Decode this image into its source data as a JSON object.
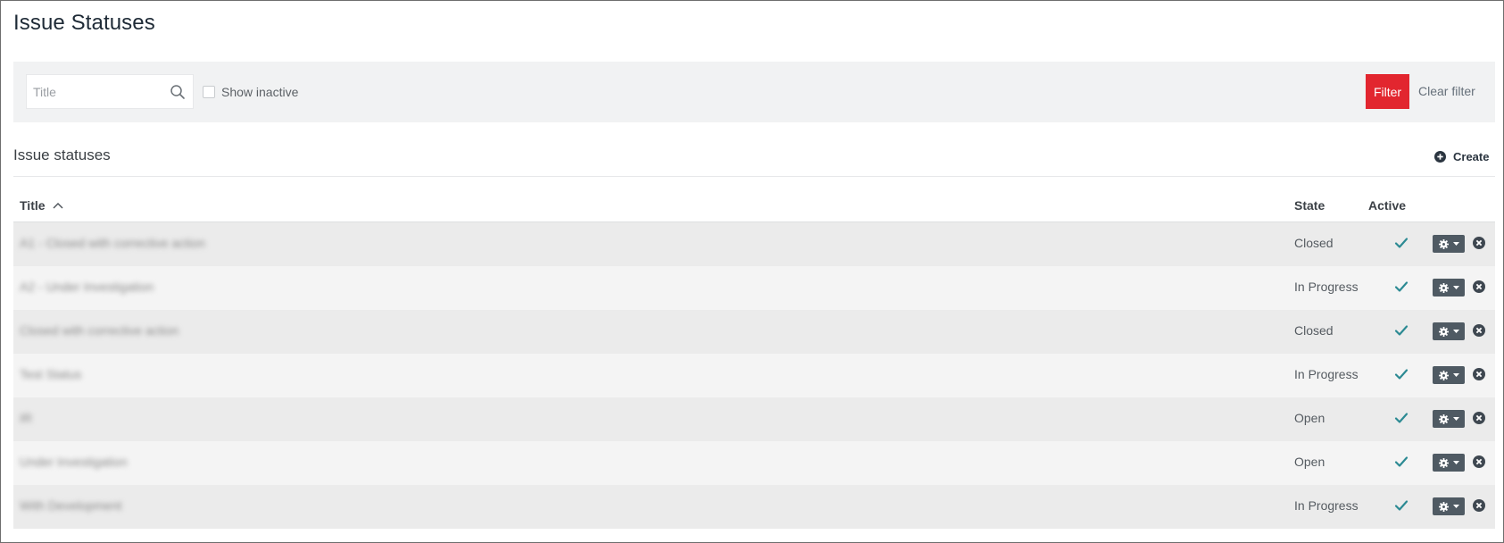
{
  "page": {
    "title": "Issue Statuses"
  },
  "filter": {
    "search_placeholder": "Title",
    "search_value": "",
    "show_inactive_label": "Show inactive",
    "show_inactive_checked": false,
    "filter_label": "Filter",
    "clear_label": "Clear filter",
    "accent_color": "#e2262f"
  },
  "section": {
    "title": "Issue statuses",
    "create_label": "Create"
  },
  "table": {
    "columns": {
      "title": "Title",
      "state": "State",
      "active": "Active"
    },
    "sort": {
      "column": "Title",
      "direction": "asc"
    },
    "rows": [
      {
        "title": "A1 - Closed with corrective action",
        "state": "Closed",
        "active": true
      },
      {
        "title": "A2 - Under Investigation",
        "state": "In Progress",
        "active": true
      },
      {
        "title": "Closed with corrective action",
        "state": "Closed",
        "active": true
      },
      {
        "title": "Test Status",
        "state": "In Progress",
        "active": true
      },
      {
        "title": "IR",
        "state": "Open",
        "active": true
      },
      {
        "title": "Under Investigation",
        "state": "Open",
        "active": true
      },
      {
        "title": "With Development",
        "state": "In Progress",
        "active": true
      }
    ]
  }
}
